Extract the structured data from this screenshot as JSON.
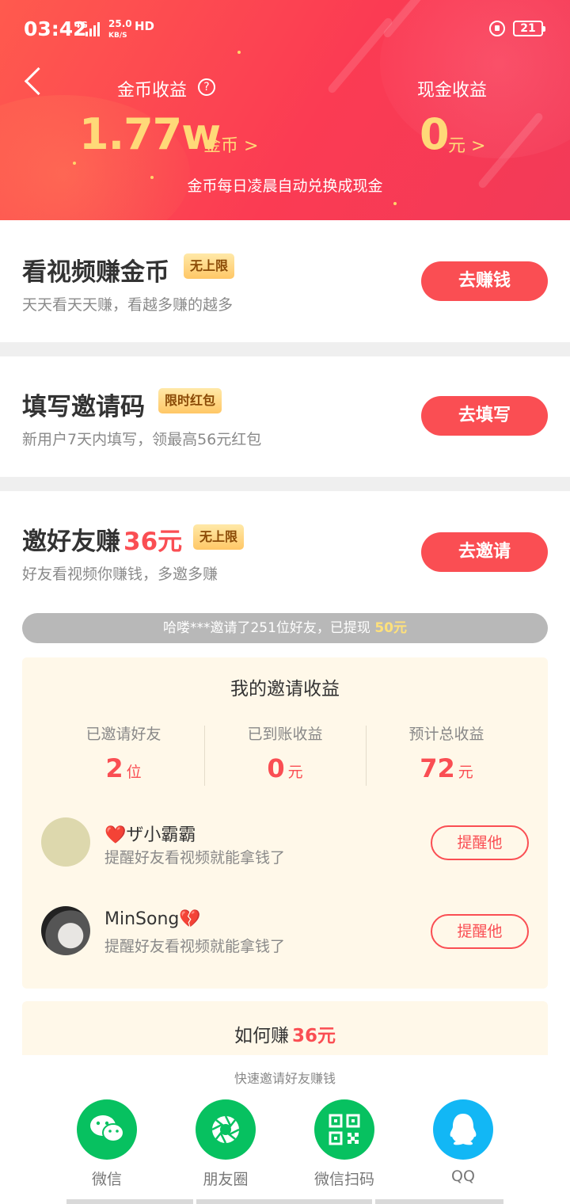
{
  "status_bar": {
    "time": "03:42",
    "network": "4G",
    "speed_value": "25.0",
    "speed_unit": "KB/S",
    "hd": "HD",
    "battery": "21"
  },
  "header": {
    "coin_title": "金币收益",
    "help_symbol": "?",
    "coin_value": "1.77w",
    "coin_unit": "金币 >",
    "cash_title": "现金收益",
    "cash_value": "0",
    "cash_unit": "元 >",
    "note": "金币每日凌晨自动兑换成现金"
  },
  "tasks": [
    {
      "title": "看视频赚金币",
      "badge": "无上限",
      "subtitle": "天天看天天赚，看越多赚的越多",
      "button": "去赚钱"
    },
    {
      "title": "填写邀请码",
      "badge": "限时红包",
      "subtitle": "新用户7天内填写，领最高56元红包",
      "button": "去填写"
    },
    {
      "title": "邀好友赚",
      "title_amount": "36元",
      "badge": "无上限",
      "subtitle": "好友看视频你赚钱，多邀多赚",
      "button": "去邀请"
    }
  ],
  "ticker": {
    "text": "哈喽***邀请了251位好友，已提现",
    "amount": "50元"
  },
  "earnings": {
    "title": "我的邀请收益",
    "stats": [
      {
        "label": "已邀请好友",
        "value": "2",
        "unit": "位"
      },
      {
        "label": "已到账收益",
        "value": "0",
        "unit": "元"
      },
      {
        "label": "预计总收益",
        "value": "72",
        "unit": "元"
      }
    ],
    "friends": [
      {
        "name": "❤️ザ小霸霸",
        "subtitle": "提醒好友看视频就能拿钱了",
        "button": "提醒他"
      },
      {
        "name": "MinSong💔",
        "subtitle": "提醒好友看视频就能拿钱了",
        "button": "提醒他"
      }
    ]
  },
  "howto": {
    "title": "如何赚",
    "amount": "36元"
  },
  "share": {
    "caption": "快速邀请好友赚钱",
    "items": [
      {
        "label": "微信",
        "icon": "wechat-icon",
        "color": "#07c160"
      },
      {
        "label": "朋友圈",
        "icon": "moments-icon",
        "color": "#07c160"
      },
      {
        "label": "微信扫码",
        "icon": "qr-code-icon",
        "color": "#07c160"
      },
      {
        "label": "QQ",
        "icon": "qq-icon",
        "color": "#12b7f5"
      }
    ]
  },
  "colors": {
    "accent": "#fa4e53",
    "gold": "#ffd978",
    "panel_bg": "#fff8e9"
  }
}
